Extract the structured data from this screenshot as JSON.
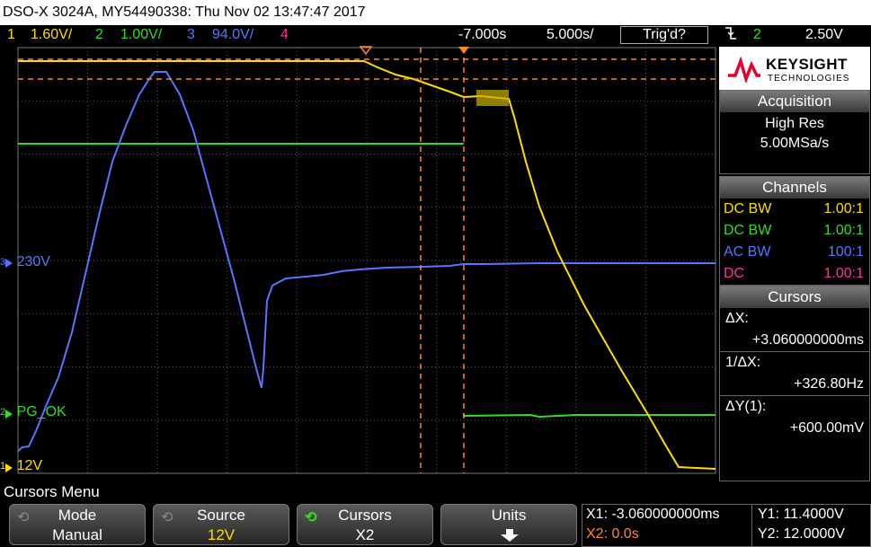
{
  "title": "DSO-X 3024A, MY54490338: Thu Nov 02 13:47:47 2017",
  "colors": {
    "ch1": "#ffdd00",
    "ch2": "#33dd22",
    "ch3": "#5577ff",
    "ch4": "#ff3399",
    "cursor": "#ff8a1c",
    "grid": "#5a5a5a"
  },
  "status": {
    "ch1_num": "1",
    "ch1_scale": "1.60V/",
    "ch2_num": "2",
    "ch2_scale": "1.00V/",
    "ch3_num": "3",
    "ch3_scale": "94.0V/",
    "ch4_num": "4",
    "delay": "-7.000s",
    "timebase": "5.000s/",
    "trig_state": "Trig'd?",
    "trig_icon": "falling-edge-icon",
    "trig_ch": "2",
    "trig_level": "2.50V"
  },
  "brand": {
    "name": "KEYSIGHT",
    "sub": "TECHNOLOGIES"
  },
  "acquisition": {
    "header": "Acquisition",
    "mode": "High Res",
    "rate": "5.00MSa/s"
  },
  "channels": {
    "header": "Channels",
    "rows": [
      {
        "coupling": "DC BW",
        "probe": "1.00:1"
      },
      {
        "coupling": "DC BW",
        "probe": "1.00:1"
      },
      {
        "coupling": "AC BW",
        "probe": "100:1"
      },
      {
        "coupling": "DC",
        "probe": "1.00:1"
      }
    ]
  },
  "cursors_panel": {
    "header": "Cursors",
    "dx_label": "ΔX:",
    "dx_value": "+3.060000000ms",
    "inv_label": "1/ΔX:",
    "inv_value": "+326.80Hz",
    "dy_label": "ΔY(1):",
    "dy_value": "+600.00mV"
  },
  "labels": {
    "ch3": "230V",
    "ch2": "PG_OK",
    "ch1": "12V",
    "ch3_num": "3",
    "ch2_num": "2",
    "ch1_num": "1"
  },
  "menu_title": "Cursors Menu",
  "softkeys": [
    {
      "line1": "Mode",
      "line2": "Manual"
    },
    {
      "line1": "Source",
      "line2": "12V"
    },
    {
      "line1": "Cursors",
      "line2": "X2"
    },
    {
      "line1": "Units",
      "line2": ""
    }
  ],
  "readout": {
    "x1": "X1: -3.060000000ms",
    "x2": "X2: 0.0s",
    "y1": "Y1: 11.4000V",
    "y2": "Y2: 12.0000V"
  }
}
